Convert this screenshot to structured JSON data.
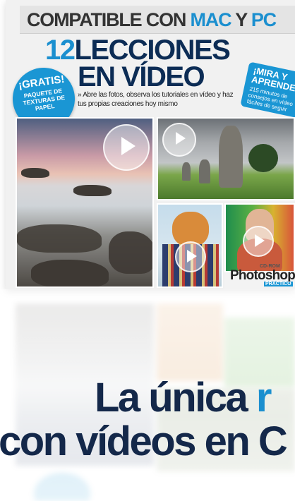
{
  "cover": {
    "compat_prefix": "COMPATIBLE CON ",
    "compat_mac": "MAC",
    "compat_y": " Y ",
    "compat_pc": "PC",
    "headline_number": "12",
    "headline_word1": "LECCIONES",
    "headline_line2": "EN VÍDEO",
    "subline": "» Abre las fotos, observa los tutoriales en vídeo y haz tus propias creaciones hoy mismo",
    "gratis_title": "¡GRATIS!",
    "gratis_sub": "PAQUETE DE TEXTURAS DE PAPEL",
    "mira_title": "¡MIRA Y APRENDE!",
    "mira_sub": "215 minutos de consejos en vídeo fáciles de seguir",
    "ps_top": "CD-ROM",
    "ps_brand": "Photoshop",
    "ps_sub": "PRÁCTICO"
  },
  "promo": {
    "line1_start": "La única ",
    "line1_accent": "r",
    "line2": "con vídeos en C"
  },
  "colors": {
    "accent": "#1b8fcf",
    "navy": "#0c2c55",
    "badge": "#1a96d4"
  }
}
